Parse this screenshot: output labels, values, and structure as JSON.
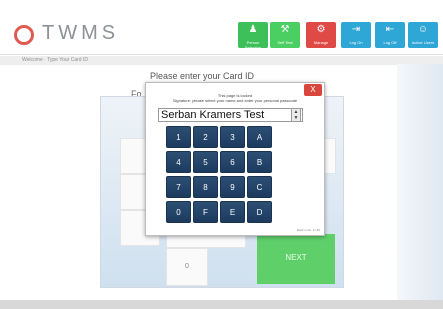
{
  "header": {
    "logo_text": "TWMS",
    "buttons": [
      {
        "icon": "person-icon",
        "glyph": "♟",
        "label": "Person Selection",
        "color": "#3dbf5a"
      },
      {
        "icon": "tools-icon",
        "glyph": "⚒",
        "label": "Self Test",
        "color": "#4bcf62"
      },
      {
        "icon": "manage-icon",
        "glyph": "⚙",
        "label": "Manage",
        "color": "#e04a46"
      },
      {
        "icon": "logon-icon",
        "glyph": "⇥",
        "label": "Log On",
        "color": "#2ea6d6"
      },
      {
        "icon": "logoff-icon",
        "glyph": "⇤",
        "label": "Log Off",
        "color": "#2ea6d6"
      },
      {
        "icon": "user-icon",
        "glyph": "☺",
        "label": "Active Users",
        "color": "#2ea6d6"
      }
    ]
  },
  "breadcrumb": "Welcome · Type Your Card ID",
  "background": {
    "prompt": "Please enter your Card ID",
    "partial": "Fo",
    "zero_label": "0",
    "next_label": "NEXT"
  },
  "modal": {
    "close_label": "X",
    "title": "This page is locked",
    "subtitle": "Signature: please select your name and enter your personal passcode",
    "selected_user": "Serban Kramers Test",
    "keys": [
      "1",
      "2",
      "3",
      "A",
      "4",
      "5",
      "6",
      "B",
      "7",
      "8",
      "9",
      "C",
      "0",
      "F",
      "E",
      "D"
    ],
    "footer": "Back Lock: 17:46"
  },
  "colors": {
    "accent": "#e05a52",
    "key_blue": "#1c3b5f",
    "next_green": "#5fcf6a",
    "close_red": "#d9463b"
  }
}
